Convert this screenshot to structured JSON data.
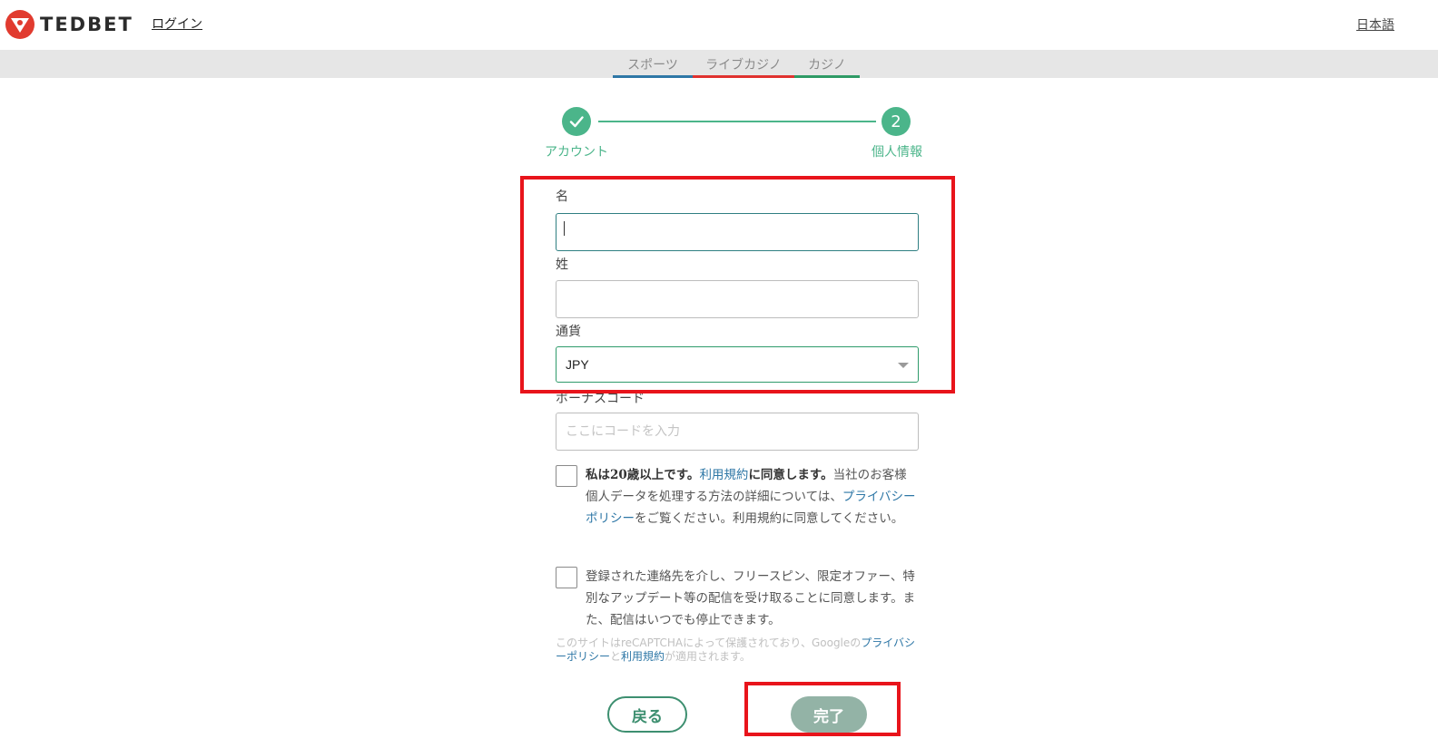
{
  "header": {
    "brand": "TEDBET",
    "login_label": "ログイン",
    "language_label": "日本語"
  },
  "nav": {
    "tabs": [
      {
        "label": "スポーツ",
        "color": "#2e77a6"
      },
      {
        "label": "ライブカジノ",
        "color": "#e0322f"
      },
      {
        "label": "カジノ",
        "color": "#2e9a65"
      }
    ]
  },
  "stepper": {
    "step1_label": "アカウント",
    "step2_number": "2",
    "step2_label": "個人情報",
    "accent_color": "#4bb58a"
  },
  "form": {
    "first_name_label": "名",
    "first_name_value": "",
    "last_name_label": "姓",
    "last_name_value": "",
    "currency_label": "通貨",
    "currency_value": "JPY",
    "bonus_label": "ボーナスコード",
    "bonus_placeholder": "ここにコードを入力",
    "consent_age": {
      "part1": "私は20歳以上です。",
      "terms_link": "利用規約",
      "part2": "に同意します。",
      "part3": "当社のお客様個人データを処理する方法の詳細については、",
      "privacy_link": "プライバシーポリシー",
      "part4": "をご覧ください。利用規約に同意してください。"
    },
    "consent_marketing": "登録された連絡先を介し、フリースピン、限定オファー、特別なアップデート等の配信を受け取ることに同意します。また、配信はいつでも停止できます。",
    "recaptcha": {
      "part1": "このサイトはreCAPTCHAによって保護されており、Googleの",
      "privacy_link": "プライバシーポリシー",
      "and": "と",
      "terms_link": "利用規約",
      "part2": "が適用されます。"
    }
  },
  "buttons": {
    "back_label": "戻る",
    "done_label": "完了"
  }
}
